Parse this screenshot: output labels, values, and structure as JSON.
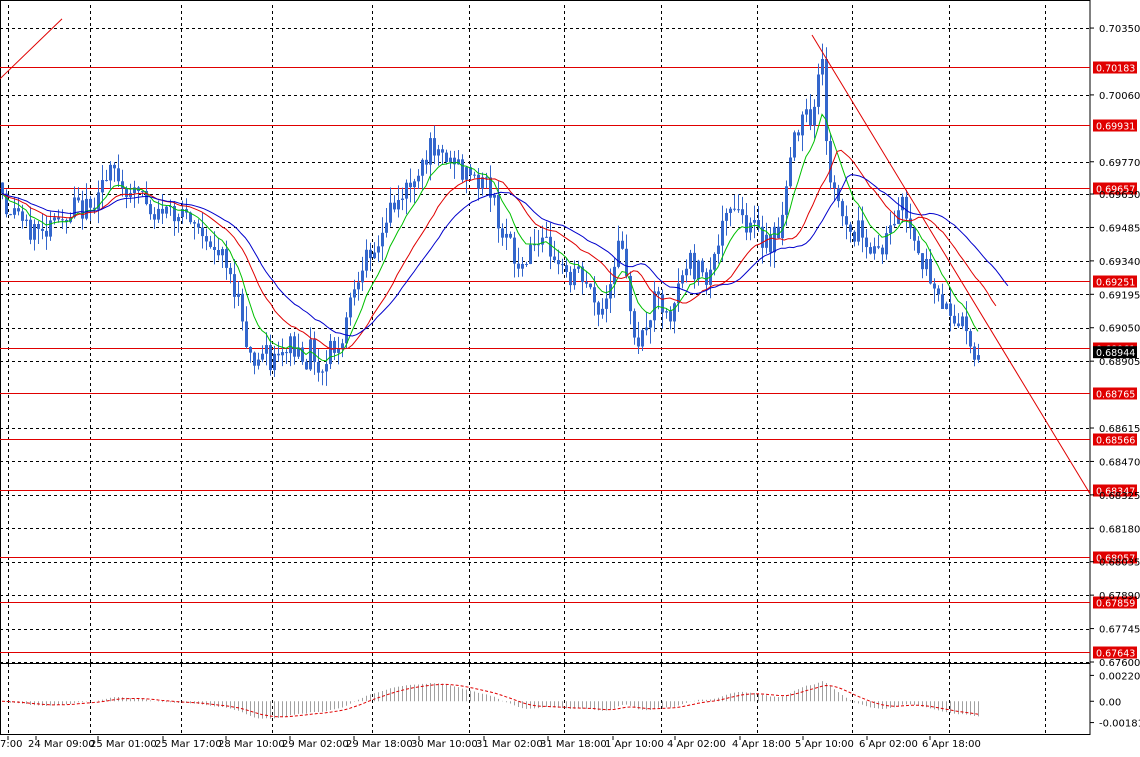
{
  "chart_data": [
    {
      "type": "candlestick",
      "y_range": [
        0.676,
        0.7045
      ],
      "y_ticks": [
        "0.70350",
        "0.70060",
        "0.69770",
        "0.69630",
        "0.69485",
        "0.69340",
        "0.69195",
        "0.69050",
        "0.68905",
        "0.68615",
        "0.68470",
        "0.68325",
        "0.68180",
        "0.68035",
        "0.67890",
        "0.67745",
        "0.67600"
      ],
      "x_ticks": [
        "7:00",
        "24 Mar 09:00",
        "25 Mar 01:00",
        "25 Mar 17:00",
        "28 Mar 10:00",
        "29 Mar 02:00",
        "29 Mar 18:00",
        "30 Mar 10:00",
        "31 Mar 02:00",
        "31 Mar 18:00",
        "1 Apr 10:00",
        "4 Apr 02:00",
        "4 Apr 18:00",
        "5 Apr 10:00",
        "6 Apr 02:00",
        "6 Apr 18:00"
      ],
      "current_price": "0.68944",
      "horizontal_levels": [
        "0.70183",
        "0.69931",
        "0.69657",
        "0.69251",
        "0.68961",
        "0.68765",
        "0.68566",
        "0.68347",
        "0.68057",
        "0.67859",
        "0.67643"
      ],
      "price_path": [
        [
          0,
          0.6968
        ],
        [
          5,
          0.6958
        ],
        [
          10,
          0.6952
        ],
        [
          15,
          0.696
        ],
        [
          20,
          0.6953
        ],
        [
          25,
          0.6948
        ],
        [
          30,
          0.6946
        ],
        [
          35,
          0.695
        ],
        [
          40,
          0.6945
        ],
        [
          45,
          0.6947
        ],
        [
          50,
          0.6952
        ],
        [
          55,
          0.6958
        ],
        [
          60,
          0.695
        ],
        [
          65,
          0.6948
        ],
        [
          70,
          0.6952
        ],
        [
          75,
          0.696
        ],
        [
          80,
          0.6955
        ],
        [
          85,
          0.6958
        ],
        [
          90,
          0.6955
        ],
        [
          95,
          0.6962
        ],
        [
          100,
          0.697
        ],
        [
          105,
          0.6966
        ],
        [
          110,
          0.6972
        ],
        [
          115,
          0.6973
        ],
        [
          120,
          0.6968
        ],
        [
          125,
          0.6964
        ],
        [
          130,
          0.6966
        ],
        [
          135,
          0.6962
        ],
        [
          140,
          0.6966
        ],
        [
          145,
          0.696
        ],
        [
          150,
          0.6952
        ],
        [
          155,
          0.695
        ],
        [
          160,
          0.6958
        ],
        [
          165,
          0.6955
        ],
        [
          170,
          0.6957
        ],
        [
          175,
          0.6953
        ],
        [
          180,
          0.696
        ],
        [
          185,
          0.6952
        ],
        [
          190,
          0.6948
        ],
        [
          195,
          0.695
        ],
        [
          200,
          0.6946
        ],
        [
          205,
          0.6947
        ],
        [
          210,
          0.694
        ],
        [
          215,
          0.6935
        ],
        [
          220,
          0.6938
        ],
        [
          225,
          0.6932
        ],
        [
          230,
          0.6926
        ],
        [
          235,
          0.6922
        ],
        [
          240,
          0.6915
        ],
        [
          245,
          0.6902
        ],
        [
          250,
          0.6893
        ],
        [
          255,
          0.689
        ],
        [
          260,
          0.6893
        ],
        [
          265,
          0.6894
        ],
        [
          270,
          0.6889
        ],
        [
          275,
          0.6893
        ],
        [
          280,
          0.689
        ],
        [
          285,
          0.6895
        ],
        [
          290,
          0.69
        ],
        [
          295,
          0.6893
        ],
        [
          300,
          0.6897
        ],
        [
          305,
          0.689
        ],
        [
          310,
          0.6896
        ],
        [
          315,
          0.6892
        ],
        [
          320,
          0.6885
        ],
        [
          325,
          0.6888
        ],
        [
          330,
          0.6902
        ],
        [
          335,
          0.6892
        ],
        [
          340,
          0.6896
        ],
        [
          345,
          0.691
        ],
        [
          350,
          0.6918
        ],
        [
          355,
          0.6925
        ],
        [
          360,
          0.6932
        ],
        [
          365,
          0.6936
        ],
        [
          370,
          0.6931
        ],
        [
          375,
          0.6938
        ],
        [
          380,
          0.6945
        ],
        [
          385,
          0.695
        ],
        [
          390,
          0.6958
        ],
        [
          395,
          0.6955
        ],
        [
          400,
          0.6962
        ],
        [
          405,
          0.6966
        ],
        [
          410,
          0.6965
        ],
        [
          415,
          0.6972
        ],
        [
          420,
          0.6976
        ],
        [
          425,
          0.6979
        ],
        [
          430,
          0.6983
        ],
        [
          435,
          0.6976
        ],
        [
          440,
          0.6982
        ],
        [
          445,
          0.6978
        ],
        [
          450,
          0.6976
        ],
        [
          455,
          0.698
        ],
        [
          460,
          0.6972
        ],
        [
          465,
          0.697
        ],
        [
          470,
          0.6974
        ],
        [
          475,
          0.6971
        ],
        [
          480,
          0.6966
        ],
        [
          485,
          0.697
        ],
        [
          490,
          0.6964
        ],
        [
          495,
          0.6958
        ],
        [
          500,
          0.6948
        ],
        [
          505,
          0.6945
        ],
        [
          510,
          0.694
        ],
        [
          515,
          0.6932
        ],
        [
          520,
          0.693
        ],
        [
          525,
          0.6935
        ],
        [
          530,
          0.6941
        ],
        [
          535,
          0.6945
        ],
        [
          540,
          0.6938
        ],
        [
          545,
          0.6942
        ],
        [
          550,
          0.6932
        ],
        [
          555,
          0.6938
        ],
        [
          560,
          0.6932
        ],
        [
          565,
          0.6931
        ],
        [
          570,
          0.6925
        ],
        [
          575,
          0.693
        ],
        [
          580,
          0.6927
        ],
        [
          585,
          0.6925
        ],
        [
          590,
          0.692
        ],
        [
          595,
          0.6914
        ],
        [
          600,
          0.6911
        ],
        [
          605,
          0.6918
        ],
        [
          610,
          0.6925
        ],
        [
          615,
          0.6938
        ],
        [
          620,
          0.6942
        ],
        [
          625,
          0.6926
        ],
        [
          630,
          0.6915
        ],
        [
          635,
          0.6901
        ],
        [
          640,
          0.6898
        ],
        [
          645,
          0.6905
        ],
        [
          650,
          0.691
        ],
        [
          655,
          0.6918
        ],
        [
          660,
          0.6915
        ],
        [
          665,
          0.691
        ],
        [
          670,
          0.6905
        ],
        [
          675,
          0.6917
        ],
        [
          680,
          0.6926
        ],
        [
          685,
          0.6931
        ],
        [
          690,
          0.6935
        ],
        [
          695,
          0.6928
        ],
        [
          700,
          0.6933
        ],
        [
          705,
          0.6927
        ],
        [
          710,
          0.6932
        ],
        [
          715,
          0.6937
        ],
        [
          720,
          0.6945
        ],
        [
          725,
          0.695
        ],
        [
          730,
          0.6957
        ],
        [
          735,
          0.696
        ],
        [
          740,
          0.6956
        ],
        [
          745,
          0.695
        ],
        [
          750,
          0.6952
        ],
        [
          755,
          0.6948
        ],
        [
          760,
          0.6943
        ],
        [
          765,
          0.6945
        ],
        [
          770,
          0.6942
        ],
        [
          775,
          0.6948
        ],
        [
          780,
          0.6947
        ],
        [
          785,
          0.6962
        ],
        [
          790,
          0.6978
        ],
        [
          795,
          0.6988
        ],
        [
          800,
          0.6996
        ],
        [
          805,
          0.7004
        ],
        [
          810,
          0.6996
        ],
        [
          815,
          0.7002
        ],
        [
          820,
          0.702
        ],
        [
          823,
          0.7026
        ],
        [
          825,
          0.6995
        ],
        [
          828,
          0.697
        ],
        [
          832,
          0.6962
        ],
        [
          836,
          0.6968
        ],
        [
          840,
          0.6955
        ],
        [
          845,
          0.6952
        ],
        [
          850,
          0.6947
        ],
        [
          855,
          0.6945
        ],
        [
          860,
          0.695
        ],
        [
          865,
          0.6945
        ],
        [
          870,
          0.6938
        ],
        [
          875,
          0.6942
        ],
        [
          880,
          0.6938
        ],
        [
          885,
          0.6943
        ],
        [
          890,
          0.6948
        ],
        [
          895,
          0.6952
        ],
        [
          900,
          0.6962
        ],
        [
          905,
          0.6955
        ],
        [
          910,
          0.695
        ],
        [
          915,
          0.6945
        ],
        [
          920,
          0.6936
        ],
        [
          925,
          0.6932
        ],
        [
          930,
          0.6925
        ],
        [
          935,
          0.6918
        ],
        [
          940,
          0.692
        ],
        [
          945,
          0.6913
        ],
        [
          950,
          0.6914
        ],
        [
          955,
          0.6906
        ],
        [
          960,
          0.691
        ],
        [
          965,
          0.6902
        ],
        [
          970,
          0.6898
        ],
        [
          975,
          0.6894
        ],
        [
          980,
          0.6895
        ]
      ],
      "trend_lines": [
        {
          "from": [
            0,
            0.7013
          ],
          "to": [
            62,
            0.7039
          ]
        },
        {
          "from": [
            812,
            0.7032
          ],
          "to": [
            1090,
            0.6833
          ]
        }
      ],
      "ma_colors": {
        "fast": "#00c000",
        "mid": "#e00000",
        "slow": "#0000cc"
      },
      "colors": {
        "bars": "#3366cc",
        "levels": "#e00000",
        "grid": "#000000",
        "trend": "#e00000"
      }
    },
    {
      "type": "oscillator",
      "y_ticks": [
        "0.002201",
        "0.00",
        "-0.001813"
      ],
      "y_range": [
        -0.0027,
        0.003
      ],
      "colors": {
        "histogram": "#a0a0a0",
        "signal": "#e00000"
      }
    }
  ]
}
